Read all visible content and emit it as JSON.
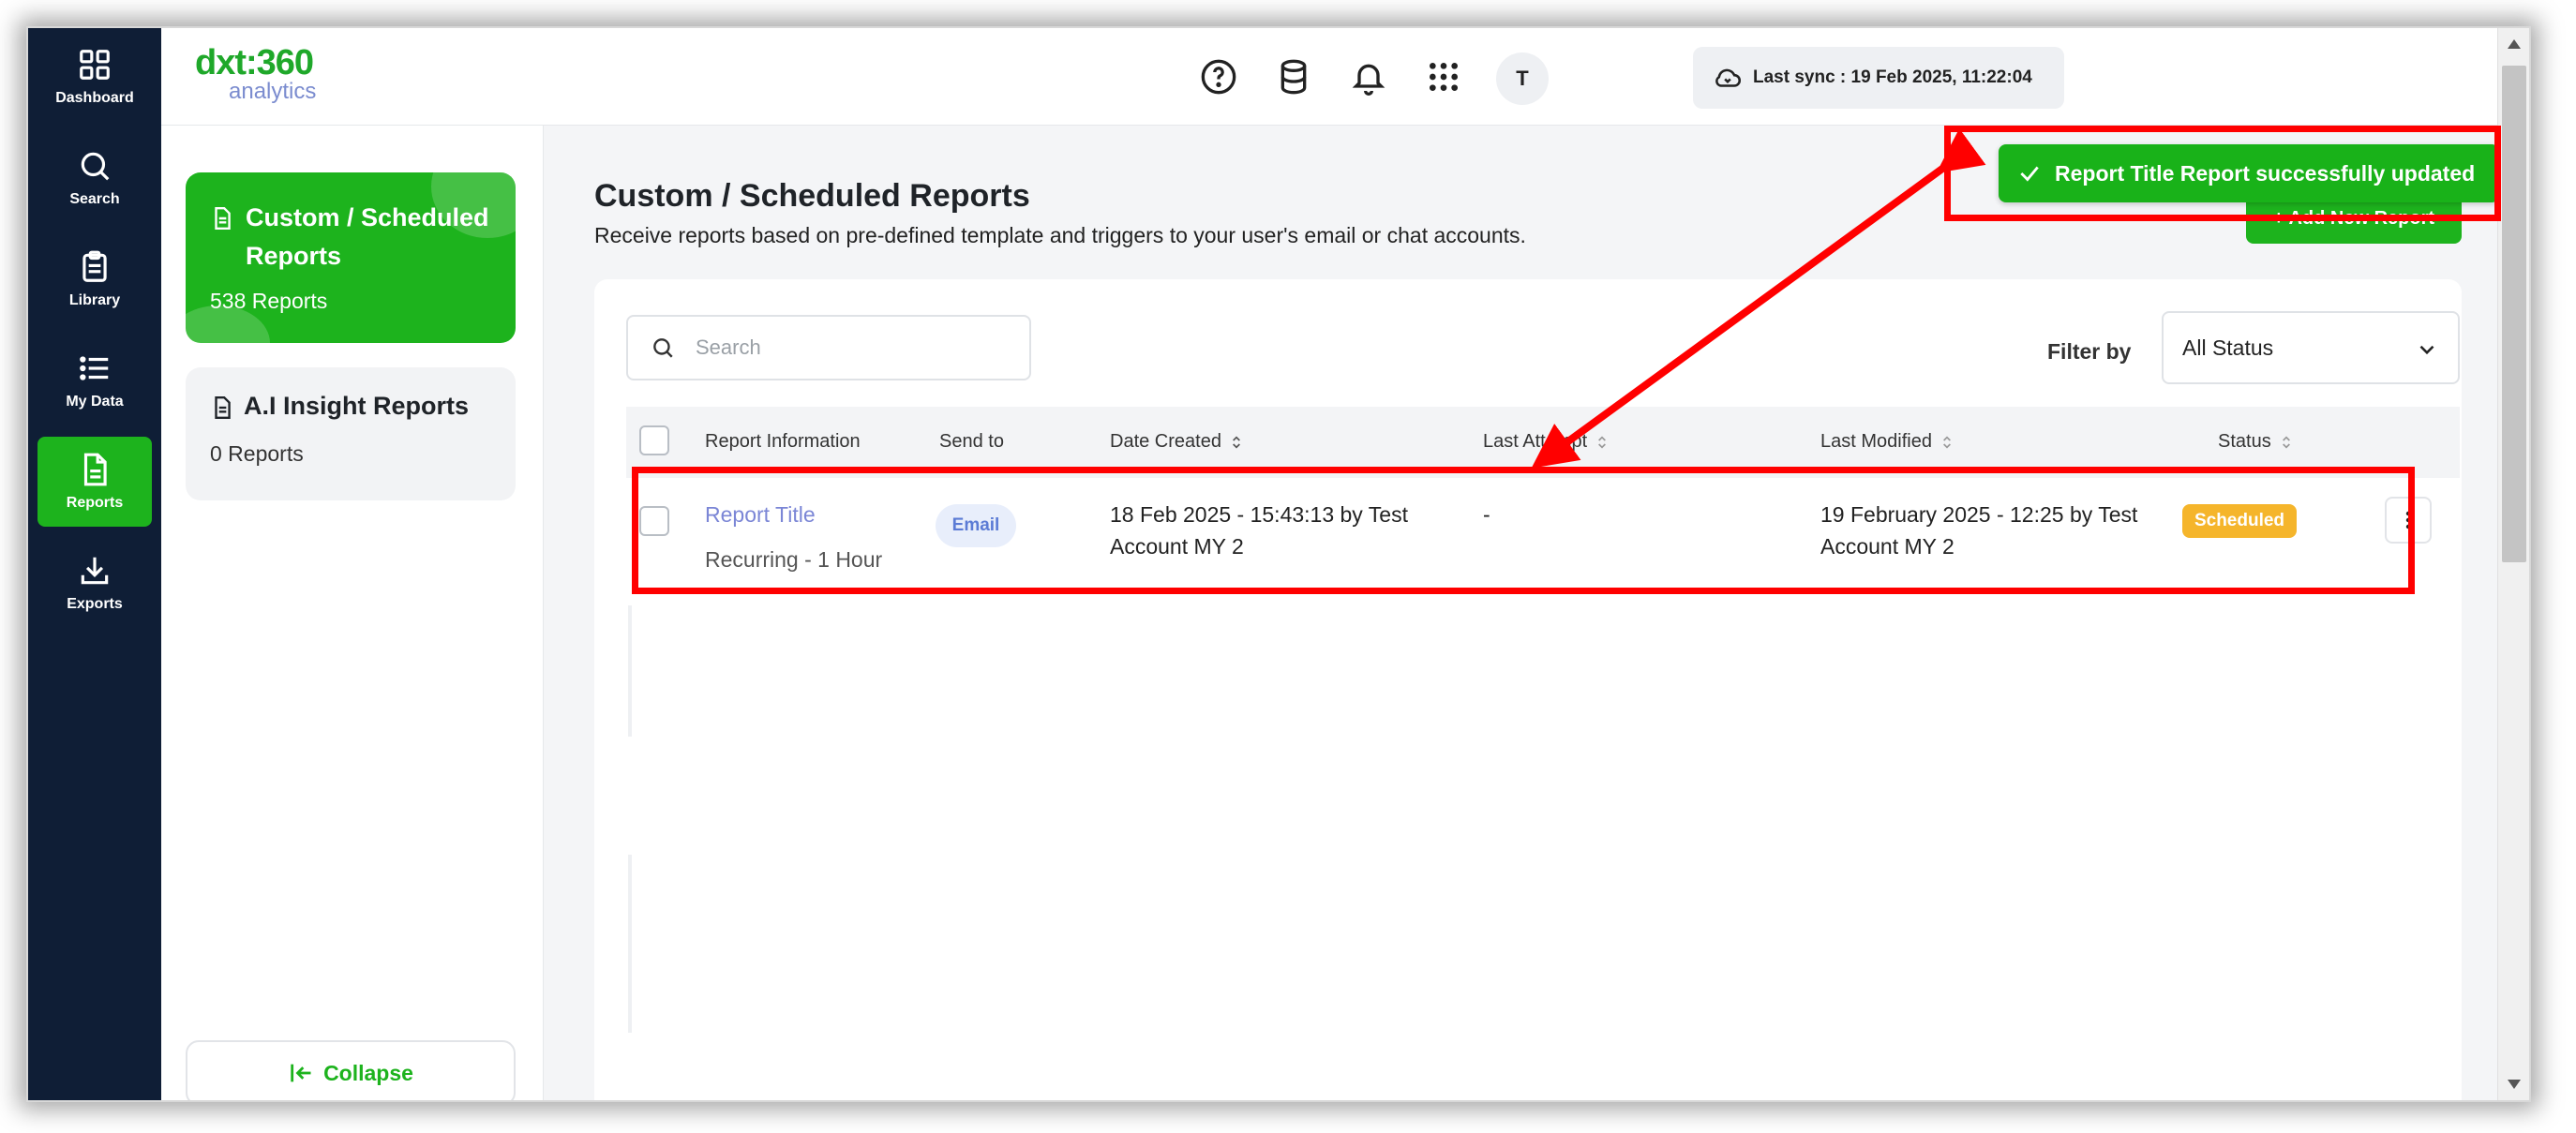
{
  "nav": {
    "items": [
      {
        "label": "Dashboard",
        "icon": "grid-icon"
      },
      {
        "label": "Search",
        "icon": "search-icon"
      },
      {
        "label": "Library",
        "icon": "clipboard-icon"
      },
      {
        "label": "My Data",
        "icon": "list-icon"
      },
      {
        "label": "Reports",
        "icon": "document-icon"
      },
      {
        "label": "Exports",
        "icon": "download-icon"
      }
    ],
    "active": "Reports"
  },
  "header": {
    "logo_top": "dxt:360",
    "logo_sub": "analytics",
    "sync_text": "Last sync : 19 Feb 2025, 11:22:04",
    "avatar_initial": "T"
  },
  "side_cards": {
    "custom": {
      "title": "Custom / Scheduled Reports",
      "count": "538 Reports"
    },
    "ai": {
      "title": "A.I Insight Reports",
      "count": "0 Reports"
    },
    "collapse_label": "Collapse"
  },
  "main": {
    "title": "Custom / Scheduled Reports",
    "subtitle": "Receive reports based on pre-defined template and triggers to your user's email or chat accounts.",
    "add_button": "+ Add New Report",
    "toast": "Report Title Report successfully updated",
    "search_placeholder": "Search",
    "filter_label": "Filter by",
    "filter_value": "All Status"
  },
  "table": {
    "headers": {
      "report_info": "Report Information",
      "send_to": "Send to",
      "date_created": "Date Created",
      "last_attempt": "Last Attempt",
      "last_modified": "Last Modified",
      "status": "Status"
    },
    "rows": [
      {
        "title": "Report Title",
        "recurrence": "Recurring - 1 Hour",
        "send_to": "Email",
        "date_created_1": "18 Feb 2025 - 15:43:13 by Test",
        "date_created_2": "Account MY 2",
        "last_attempt": "-",
        "last_modified_1": "19 February 2025 - 12:25 by Test",
        "last_modified_2": "Account MY 2",
        "status": "Scheduled"
      }
    ]
  },
  "colors": {
    "brand_green": "#1db31d",
    "nav_bg": "#0f1e36",
    "annotation_red": "#ff0000",
    "scheduled_orange": "#f5b52b"
  }
}
